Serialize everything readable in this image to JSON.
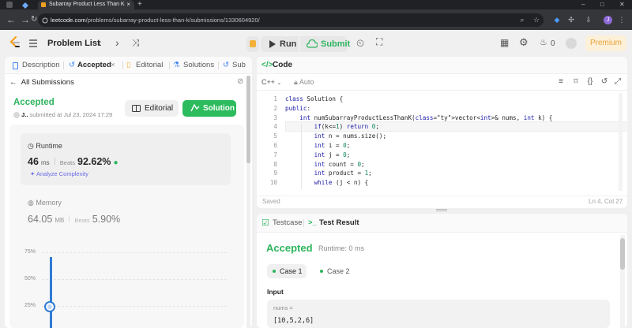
{
  "browser": {
    "tab_title": "Subarray Product Less Than K",
    "tab_close": "×",
    "new_tab": "+",
    "url_host": "leetcode.com",
    "url_path": "/problems/subarray-product-less-than-k/submissions/1330604920/",
    "profile_initial": "J",
    "window_controls": [
      "–",
      "□",
      "✕"
    ]
  },
  "nav": {
    "problem_list": "Problem List",
    "run": "Run",
    "submit": "Submit",
    "streak_count": "0",
    "premium": "Premium"
  },
  "left_tabs": [
    {
      "label": "Description"
    },
    {
      "label": "Accepted"
    },
    {
      "label": "Editorial"
    },
    {
      "label": "Solutions"
    },
    {
      "label": "Sub"
    }
  ],
  "submission": {
    "back_label": "All Submissions",
    "status": "Accepted",
    "user": "J..",
    "submitted_text": "submitted at Jul 23, 2024 17:29",
    "editorial_btn": "Editorial",
    "solution_btn": "Solution"
  },
  "runtime": {
    "label": "Runtime",
    "value": "46",
    "unit": "ms",
    "beats_label": "Beats",
    "beats_value": "92.62%",
    "analyze": "Analyze Complexity"
  },
  "memory": {
    "label": "Memory",
    "value": "64.05",
    "unit": "MB",
    "beats_label": "Beats",
    "beats_value": "5.90%"
  },
  "chart_data": {
    "type": "bar",
    "yticks": [
      "75%",
      "50%",
      "25%"
    ],
    "highlight_percentile": 25
  },
  "code": {
    "title": "Code",
    "language": "C++",
    "mode": "Auto",
    "saved": "Saved",
    "cursor": "Ln 4, Col 27",
    "lines": [
      "class Solution {",
      "public:",
      "    int numSubarrayProductLessThanK(vector<int>& nums, int k) {",
      "        if(k<=1) return 0;",
      "        int n = nums.size();",
      "        int i = 0;",
      "        int j = 0;",
      "        int count = 0;",
      "        int product = 1;",
      "        while (j < n) {"
    ]
  },
  "result": {
    "testcase_tab": "Testcase",
    "result_tab": "Test Result",
    "status": "Accepted",
    "runtime": "Runtime: 0 ms",
    "cases": [
      "Case 1",
      "Case 2"
    ],
    "input_label": "Input",
    "var_name": "nums =",
    "var_value": "[10,5,2,6]"
  },
  "colors": {
    "accent_green": "#2db55d",
    "editorial_blue": "#3b82f6",
    "chart_blue": "#2f7bd4"
  }
}
